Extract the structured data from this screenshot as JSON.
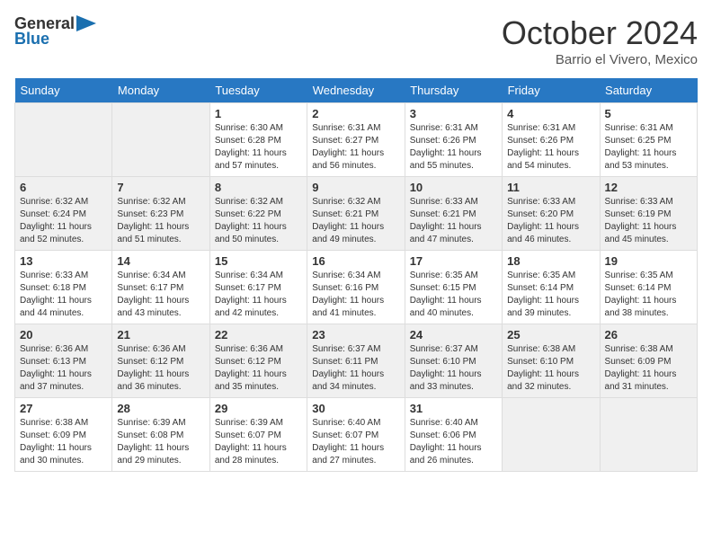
{
  "header": {
    "logo_line1": "General",
    "logo_line2": "Blue",
    "month_title": "October 2024",
    "location": "Barrio el Vivero, Mexico"
  },
  "weekdays": [
    "Sunday",
    "Monday",
    "Tuesday",
    "Wednesday",
    "Thursday",
    "Friday",
    "Saturday"
  ],
  "weeks": [
    [
      {
        "day": "",
        "sunrise": "",
        "sunset": "",
        "daylight": ""
      },
      {
        "day": "",
        "sunrise": "",
        "sunset": "",
        "daylight": ""
      },
      {
        "day": "1",
        "sunrise": "Sunrise: 6:30 AM",
        "sunset": "Sunset: 6:28 PM",
        "daylight": "Daylight: 11 hours and 57 minutes."
      },
      {
        "day": "2",
        "sunrise": "Sunrise: 6:31 AM",
        "sunset": "Sunset: 6:27 PM",
        "daylight": "Daylight: 11 hours and 56 minutes."
      },
      {
        "day": "3",
        "sunrise": "Sunrise: 6:31 AM",
        "sunset": "Sunset: 6:26 PM",
        "daylight": "Daylight: 11 hours and 55 minutes."
      },
      {
        "day": "4",
        "sunrise": "Sunrise: 6:31 AM",
        "sunset": "Sunset: 6:26 PM",
        "daylight": "Daylight: 11 hours and 54 minutes."
      },
      {
        "day": "5",
        "sunrise": "Sunrise: 6:31 AM",
        "sunset": "Sunset: 6:25 PM",
        "daylight": "Daylight: 11 hours and 53 minutes."
      }
    ],
    [
      {
        "day": "6",
        "sunrise": "Sunrise: 6:32 AM",
        "sunset": "Sunset: 6:24 PM",
        "daylight": "Daylight: 11 hours and 52 minutes."
      },
      {
        "day": "7",
        "sunrise": "Sunrise: 6:32 AM",
        "sunset": "Sunset: 6:23 PM",
        "daylight": "Daylight: 11 hours and 51 minutes."
      },
      {
        "day": "8",
        "sunrise": "Sunrise: 6:32 AM",
        "sunset": "Sunset: 6:22 PM",
        "daylight": "Daylight: 11 hours and 50 minutes."
      },
      {
        "day": "9",
        "sunrise": "Sunrise: 6:32 AM",
        "sunset": "Sunset: 6:21 PM",
        "daylight": "Daylight: 11 hours and 49 minutes."
      },
      {
        "day": "10",
        "sunrise": "Sunrise: 6:33 AM",
        "sunset": "Sunset: 6:21 PM",
        "daylight": "Daylight: 11 hours and 47 minutes."
      },
      {
        "day": "11",
        "sunrise": "Sunrise: 6:33 AM",
        "sunset": "Sunset: 6:20 PM",
        "daylight": "Daylight: 11 hours and 46 minutes."
      },
      {
        "day": "12",
        "sunrise": "Sunrise: 6:33 AM",
        "sunset": "Sunset: 6:19 PM",
        "daylight": "Daylight: 11 hours and 45 minutes."
      }
    ],
    [
      {
        "day": "13",
        "sunrise": "Sunrise: 6:33 AM",
        "sunset": "Sunset: 6:18 PM",
        "daylight": "Daylight: 11 hours and 44 minutes."
      },
      {
        "day": "14",
        "sunrise": "Sunrise: 6:34 AM",
        "sunset": "Sunset: 6:17 PM",
        "daylight": "Daylight: 11 hours and 43 minutes."
      },
      {
        "day": "15",
        "sunrise": "Sunrise: 6:34 AM",
        "sunset": "Sunset: 6:17 PM",
        "daylight": "Daylight: 11 hours and 42 minutes."
      },
      {
        "day": "16",
        "sunrise": "Sunrise: 6:34 AM",
        "sunset": "Sunset: 6:16 PM",
        "daylight": "Daylight: 11 hours and 41 minutes."
      },
      {
        "day": "17",
        "sunrise": "Sunrise: 6:35 AM",
        "sunset": "Sunset: 6:15 PM",
        "daylight": "Daylight: 11 hours and 40 minutes."
      },
      {
        "day": "18",
        "sunrise": "Sunrise: 6:35 AM",
        "sunset": "Sunset: 6:14 PM",
        "daylight": "Daylight: 11 hours and 39 minutes."
      },
      {
        "day": "19",
        "sunrise": "Sunrise: 6:35 AM",
        "sunset": "Sunset: 6:14 PM",
        "daylight": "Daylight: 11 hours and 38 minutes."
      }
    ],
    [
      {
        "day": "20",
        "sunrise": "Sunrise: 6:36 AM",
        "sunset": "Sunset: 6:13 PM",
        "daylight": "Daylight: 11 hours and 37 minutes."
      },
      {
        "day": "21",
        "sunrise": "Sunrise: 6:36 AM",
        "sunset": "Sunset: 6:12 PM",
        "daylight": "Daylight: 11 hours and 36 minutes."
      },
      {
        "day": "22",
        "sunrise": "Sunrise: 6:36 AM",
        "sunset": "Sunset: 6:12 PM",
        "daylight": "Daylight: 11 hours and 35 minutes."
      },
      {
        "day": "23",
        "sunrise": "Sunrise: 6:37 AM",
        "sunset": "Sunset: 6:11 PM",
        "daylight": "Daylight: 11 hours and 34 minutes."
      },
      {
        "day": "24",
        "sunrise": "Sunrise: 6:37 AM",
        "sunset": "Sunset: 6:10 PM",
        "daylight": "Daylight: 11 hours and 33 minutes."
      },
      {
        "day": "25",
        "sunrise": "Sunrise: 6:38 AM",
        "sunset": "Sunset: 6:10 PM",
        "daylight": "Daylight: 11 hours and 32 minutes."
      },
      {
        "day": "26",
        "sunrise": "Sunrise: 6:38 AM",
        "sunset": "Sunset: 6:09 PM",
        "daylight": "Daylight: 11 hours and 31 minutes."
      }
    ],
    [
      {
        "day": "27",
        "sunrise": "Sunrise: 6:38 AM",
        "sunset": "Sunset: 6:09 PM",
        "daylight": "Daylight: 11 hours and 30 minutes."
      },
      {
        "day": "28",
        "sunrise": "Sunrise: 6:39 AM",
        "sunset": "Sunset: 6:08 PM",
        "daylight": "Daylight: 11 hours and 29 minutes."
      },
      {
        "day": "29",
        "sunrise": "Sunrise: 6:39 AM",
        "sunset": "Sunset: 6:07 PM",
        "daylight": "Daylight: 11 hours and 28 minutes."
      },
      {
        "day": "30",
        "sunrise": "Sunrise: 6:40 AM",
        "sunset": "Sunset: 6:07 PM",
        "daylight": "Daylight: 11 hours and 27 minutes."
      },
      {
        "day": "31",
        "sunrise": "Sunrise: 6:40 AM",
        "sunset": "Sunset: 6:06 PM",
        "daylight": "Daylight: 11 hours and 26 minutes."
      },
      {
        "day": "",
        "sunrise": "",
        "sunset": "",
        "daylight": ""
      },
      {
        "day": "",
        "sunrise": "",
        "sunset": "",
        "daylight": ""
      }
    ]
  ]
}
